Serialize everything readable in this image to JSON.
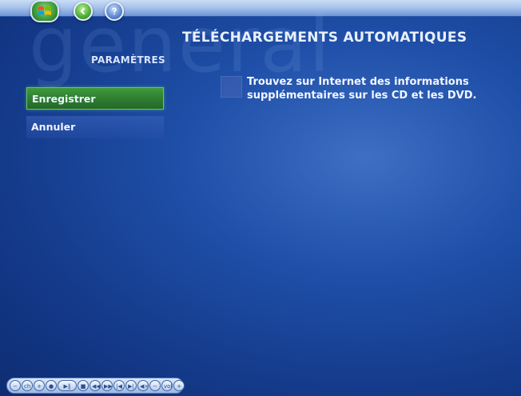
{
  "header": {
    "watermark": "general",
    "title": "TÉLÉCHARGEMENTS AUTOMATIQUES",
    "section": "PARAMÈTRES"
  },
  "menu": {
    "items": [
      {
        "label": "Enregistrer",
        "selected": true
      },
      {
        "label": "Annuler",
        "selected": false
      }
    ]
  },
  "content": {
    "info_icon": "info-square-icon",
    "text": "Trouvez sur Internet des informations supplémentaires sur les CD et les DVD."
  },
  "transport": {
    "ch_label": "ch",
    "vol_label": "vol"
  },
  "colors": {
    "accent": "#2f7f31",
    "background": "#1f4fa8"
  }
}
